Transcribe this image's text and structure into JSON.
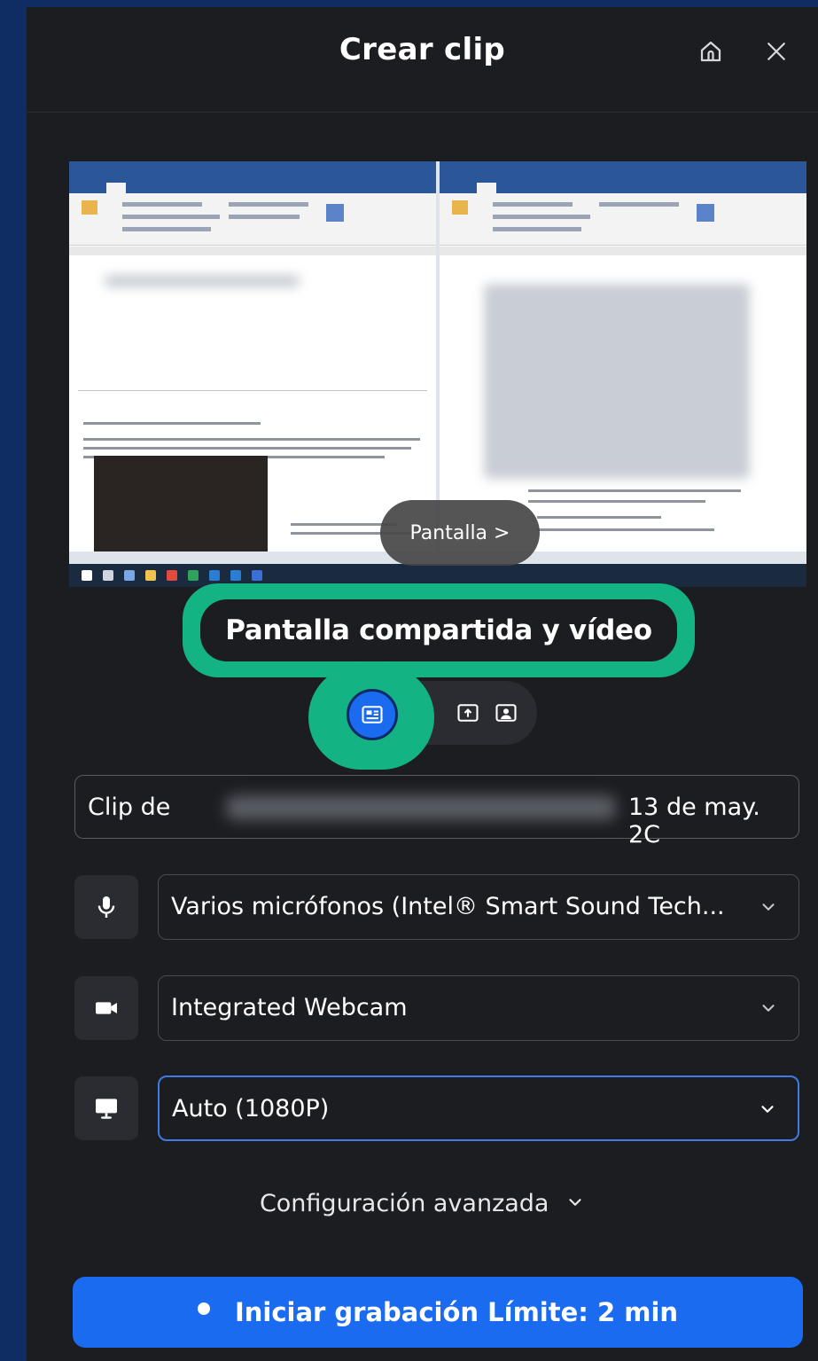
{
  "header": {
    "title": "Crear clip",
    "home_icon": "home-icon",
    "close_icon": "close-icon"
  },
  "preview": {
    "source_pill_label": "Pantalla >",
    "document_icon": "document-preview"
  },
  "mode": {
    "label": "Pantalla compartida y vídeo",
    "options": [
      {
        "name": "screen-and-video",
        "icon": "screen-video-icon",
        "selected": true
      },
      {
        "name": "screen-only",
        "icon": "screen-share-icon",
        "selected": false
      },
      {
        "name": "video-only",
        "icon": "camera-portrait-icon",
        "selected": false
      }
    ]
  },
  "clip_name": {
    "prefix": "Clip de",
    "suffix": "13 de may. 2C"
  },
  "microphone": {
    "icon": "microphone-icon",
    "value": "Varios micrófonos (Intel® Smart Sound Tech..."
  },
  "camera": {
    "icon": "video-camera-icon",
    "value": "Integrated Webcam"
  },
  "resolution": {
    "icon": "monitor-icon",
    "value": "Auto (1080P)"
  },
  "advanced": {
    "label": "Configuración avanzada"
  },
  "start_button": {
    "label": "Iniciar grabación Límite: 2 min"
  },
  "colors": {
    "accent": "#1a6bf0",
    "highlight": "#13b383",
    "panel": "#1c1d21",
    "frame": "#0f2c63"
  }
}
